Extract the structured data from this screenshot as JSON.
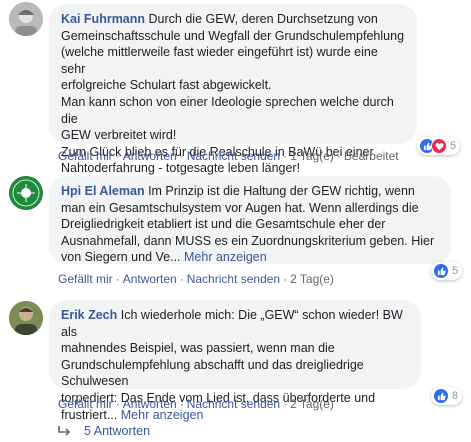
{
  "comments": [
    {
      "author": "Kai Fuhrmann",
      "lines": [
        "Durch die GEW, deren Durchsetzung von",
        "Gemeinschaftsschule und Wegfall der Grundschulempfehlung",
        "(welche mittlerweile fast wieder eingeführt ist) wurde eine sehr",
        "erfolgreiche Schulart fast abgewickelt.",
        "Man kann schon von einer Ideologie sprechen welche durch die",
        "GEW verbreitet wird!",
        "Zum Glück blieb es für die Realschule in BaWü bei einer",
        "Nahtoderfahrung - totgesagte leben länger!"
      ],
      "more": "",
      "actions": {
        "like": "Gefällt mir",
        "reply": "Antworten",
        "message": "Nachricht senden",
        "time": "1 Tag(e)",
        "edit": "Bearbeitet"
      },
      "reactions": {
        "types": [
          "like",
          "love"
        ],
        "count": "5"
      }
    },
    {
      "author": "Hpi El Aleman",
      "lines": [
        "Im Prinzip ist die Haltung der GEW richtig, wenn",
        "man ein Gesamtschulsystem vor Augen hat. Wenn allerdings die",
        "Dreigliedrigkeit etabliert ist und die Gesamtschule eher der",
        "Ausnahmefall, dann MUSS es ein Zuordnungskriterium geben. Hier",
        "von Siegern und Ve..."
      ],
      "more": "Mehr anzeigen",
      "actions": {
        "like": "Gefällt mir",
        "reply": "Antworten",
        "message": "Nachricht senden",
        "time": "2 Tag(e)"
      },
      "reactions": {
        "types": [
          "like"
        ],
        "count": "5"
      }
    },
    {
      "author": "Erik Zech",
      "lines": [
        "Ich wiederhole mich: Die „GEW“ schon wieder! BW als",
        "mahnendes Beispiel, was passiert, wenn man die",
        "Grundschulempfehlung abschafft und das dreigliedrige Schulwesen",
        "torpediert: Das Ende vom Lied ist, dass überforderte und",
        "frustriert..."
      ],
      "more": "Mehr anzeigen",
      "actions": {
        "like": "Gefällt mir",
        "reply": "Antworten",
        "message": "Nachricht senden",
        "time": "2 Tag(e)"
      },
      "reactions": {
        "types": [
          "like"
        ],
        "count": "8"
      }
    }
  ],
  "replies": {
    "label": "5 Antworten",
    "icon": "reply-arrow-icon"
  },
  "colors": {
    "link": "#385898",
    "bubble": "#f2f3f5",
    "like": "#2f6cf5",
    "love": "#f0284a",
    "meta": "#606770"
  }
}
